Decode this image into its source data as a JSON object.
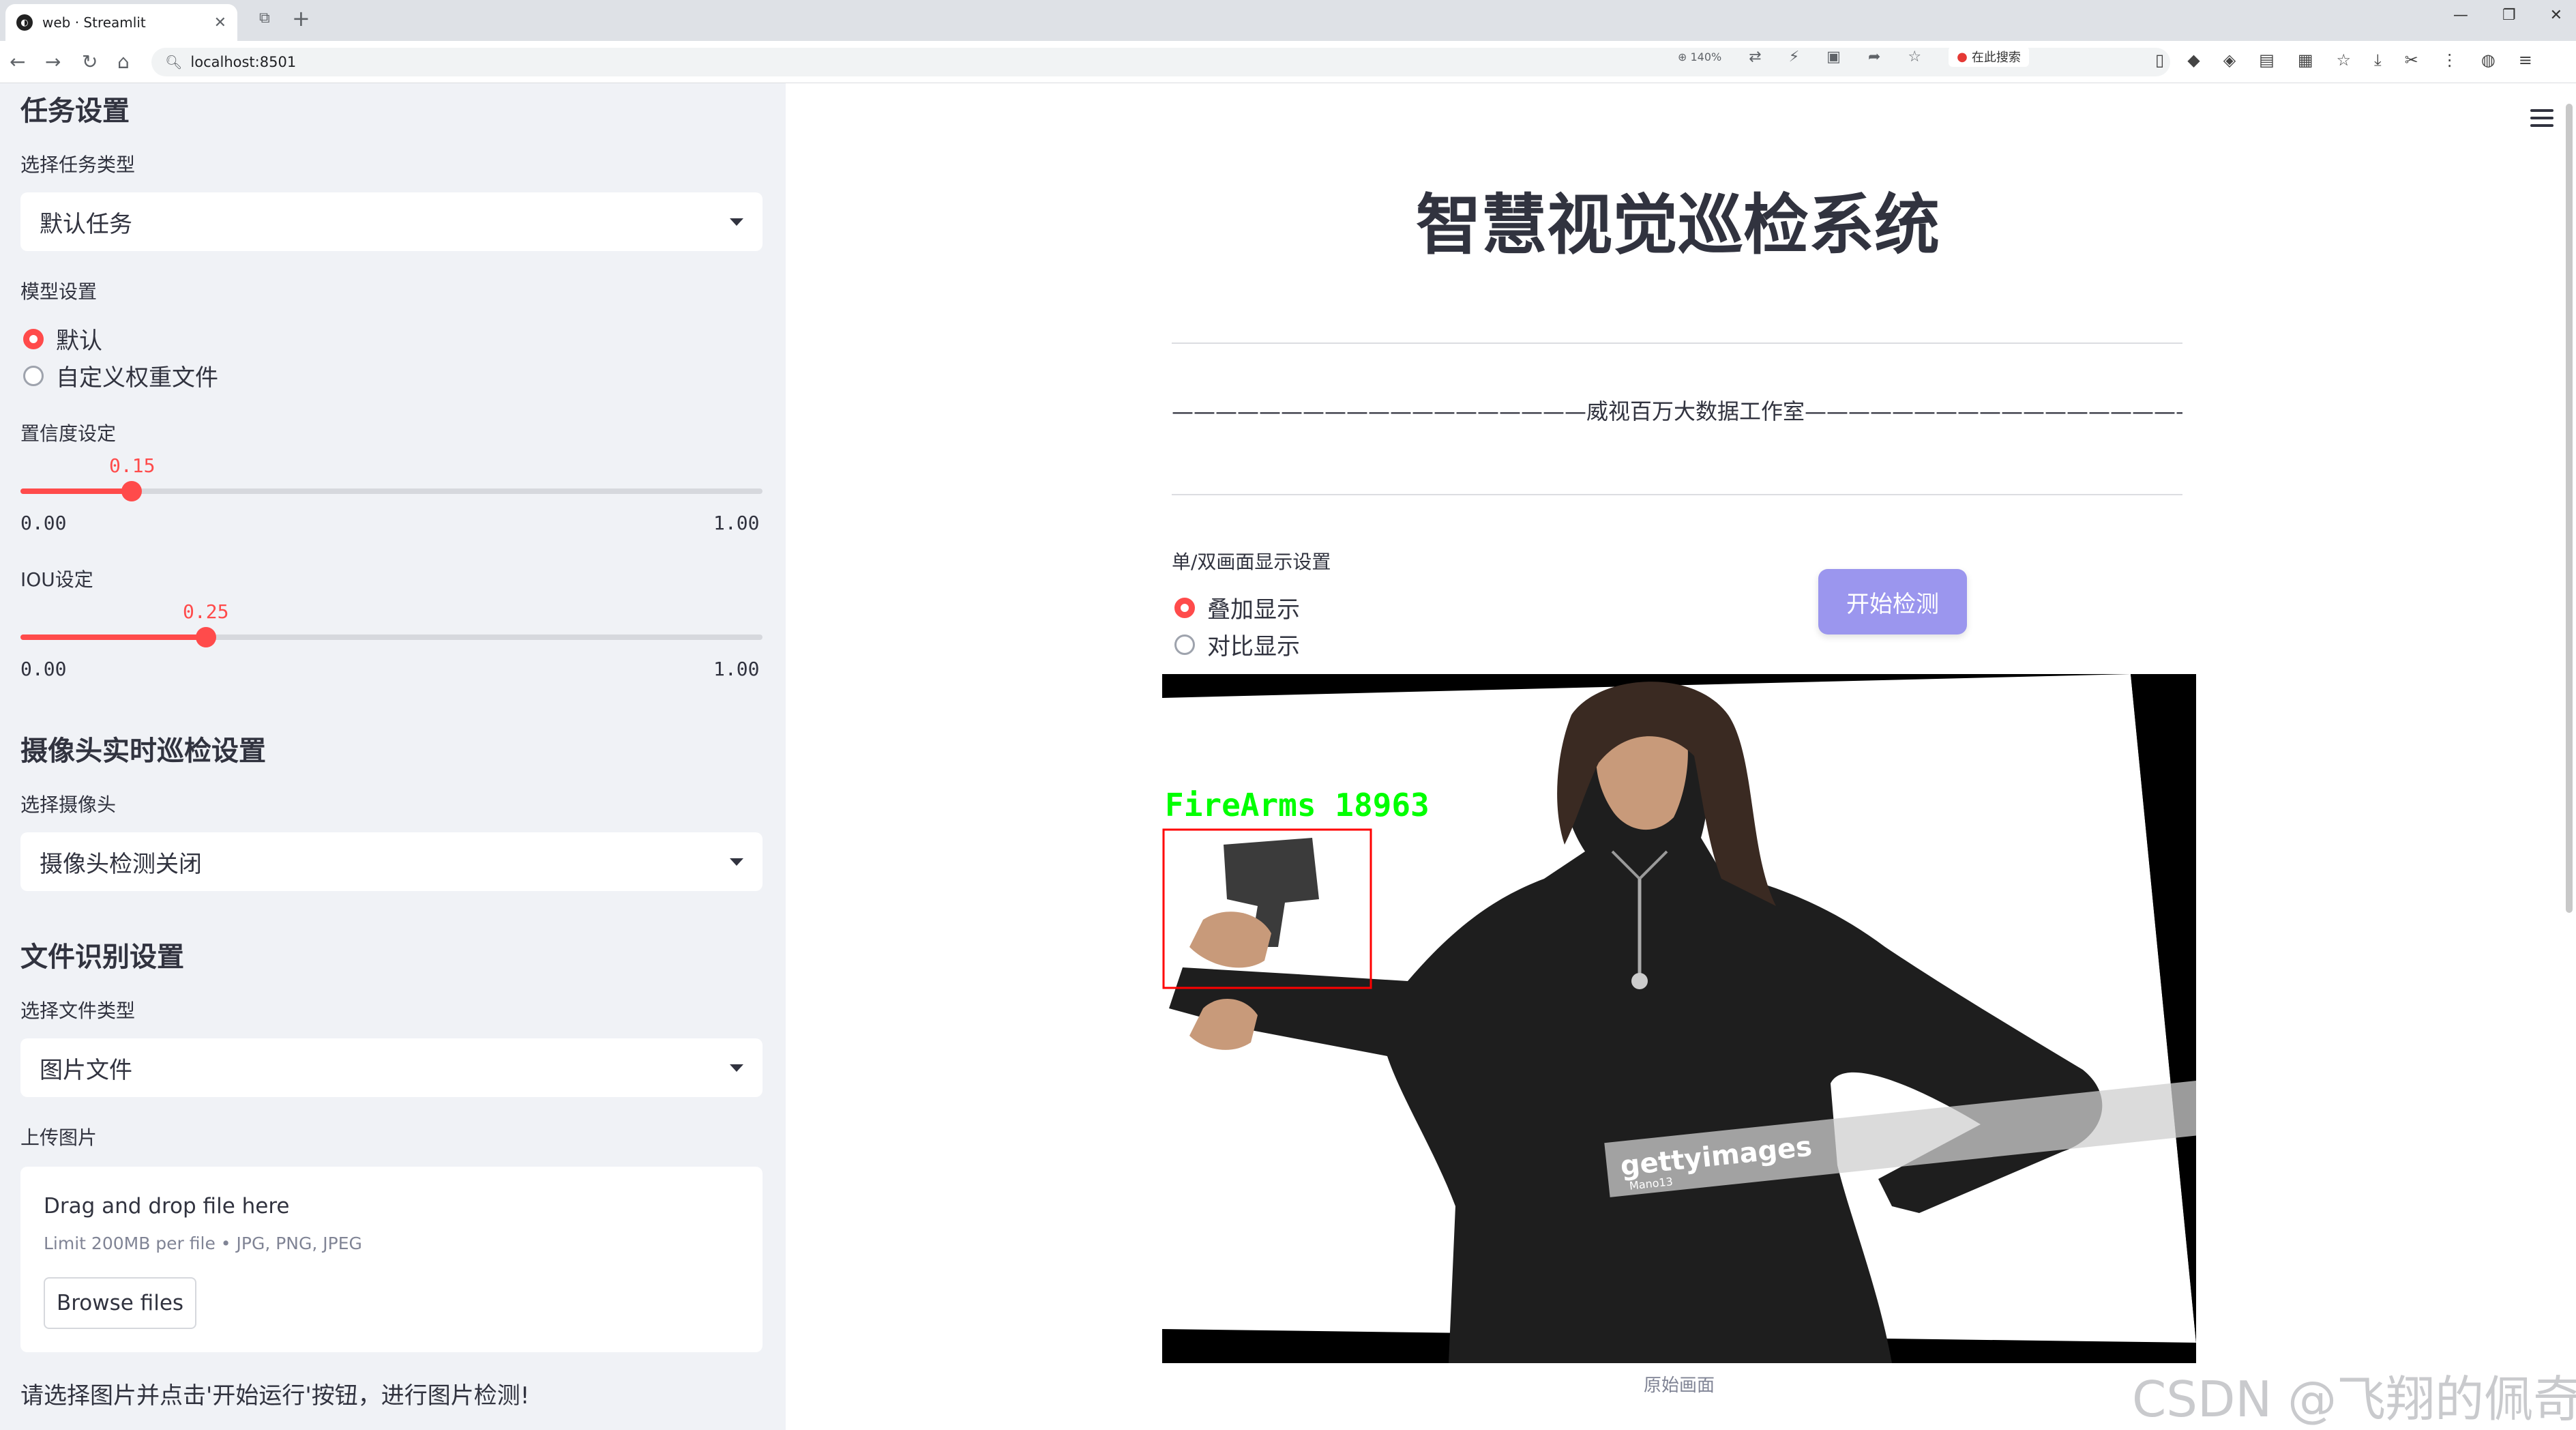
{
  "browser": {
    "tab_title": "web · Streamlit",
    "tab_favicon": "streamlit-logo-icon",
    "url": "localhost:8501",
    "zoom": "140%",
    "search_label": "在此搜索"
  },
  "sidebar": {
    "task_section_title": "任务设置",
    "task_type_label": "选择任务类型",
    "task_type_value": "默认任务",
    "model_label": "模型设置",
    "model_options": [
      "默认",
      "自定义权重文件"
    ],
    "model_selected": 0,
    "confidence_label": "置信度设定",
    "confidence_value": "0.15",
    "confidence_min": "0.00",
    "confidence_max": "1.00",
    "iou_label": "IOU设定",
    "iou_value": "0.25",
    "iou_min": "0.00",
    "iou_max": "1.00",
    "camera_section_title": "摄像头实时巡检设置",
    "camera_label": "选择摄像头",
    "camera_value": "摄像头检测关闭",
    "file_section_title": "文件识别设置",
    "file_type_label": "选择文件类型",
    "file_type_value": "图片文件",
    "upload_label": "上传图片",
    "dropzone_text": "Drag and drop file here",
    "dropzone_limit": "Limit 200MB per file • JPG, PNG, JPEG",
    "browse_button": "Browse files",
    "note": "请选择图片并点击'开始运行'按钮，进行图片检测!"
  },
  "main": {
    "title": "智慧视觉巡检系统",
    "studio_line": "———————————————————威视百万大数据工作室———————————————————",
    "display_label": "单/双画面显示设置",
    "display_options": [
      "叠加显示",
      "对比显示"
    ],
    "display_selected": 0,
    "start_button": "开始检测",
    "detection_label": "FireArms  18963",
    "image_caption": "原始画面",
    "watermark": "CSDN @飞翔的佩奇",
    "stock_watermark": "gettyimages",
    "stock_watermark_sub": "Mano13"
  },
  "colors": {
    "accent": "#ff4b4b",
    "button": "#9b96ee",
    "sidebar_bg": "#f0f2f6",
    "detection_box": "#ff0000",
    "detection_text": "#00ff00"
  }
}
